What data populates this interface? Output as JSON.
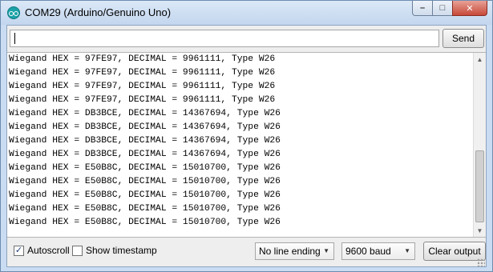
{
  "window": {
    "title": "COM29 (Arduino/Genuino Uno)",
    "icon": "arduino-icon",
    "controls": {
      "minimize": "–",
      "maximize": "□",
      "close": "✕"
    }
  },
  "input": {
    "value": "",
    "send_label": "Send"
  },
  "output": {
    "lines": [
      "Wiegand HEX = 97FE97, DECIMAL = 9961111, Type W26",
      "Wiegand HEX = 97FE97, DECIMAL = 9961111, Type W26",
      "Wiegand HEX = 97FE97, DECIMAL = 9961111, Type W26",
      "Wiegand HEX = 97FE97, DECIMAL = 9961111, Type W26",
      "Wiegand HEX = DB3BCE, DECIMAL = 14367694, Type W26",
      "Wiegand HEX = DB3BCE, DECIMAL = 14367694, Type W26",
      "Wiegand HEX = DB3BCE, DECIMAL = 14367694, Type W26",
      "Wiegand HEX = DB3BCE, DECIMAL = 14367694, Type W26",
      "Wiegand HEX = E50B8C, DECIMAL = 15010700, Type W26",
      "Wiegand HEX = E50B8C, DECIMAL = 15010700, Type W26",
      "Wiegand HEX = E50B8C, DECIMAL = 15010700, Type W26",
      "Wiegand HEX = E50B8C, DECIMAL = 15010700, Type W26",
      "Wiegand HEX = E50B8C, DECIMAL = 15010700, Type W26"
    ]
  },
  "footer": {
    "autoscroll": {
      "label": "Autoscroll",
      "checked": true
    },
    "timestamp": {
      "label": "Show timestamp",
      "checked": false
    },
    "line_ending": "No line ending",
    "baud": "9600 baud",
    "clear_label": "Clear output"
  }
}
